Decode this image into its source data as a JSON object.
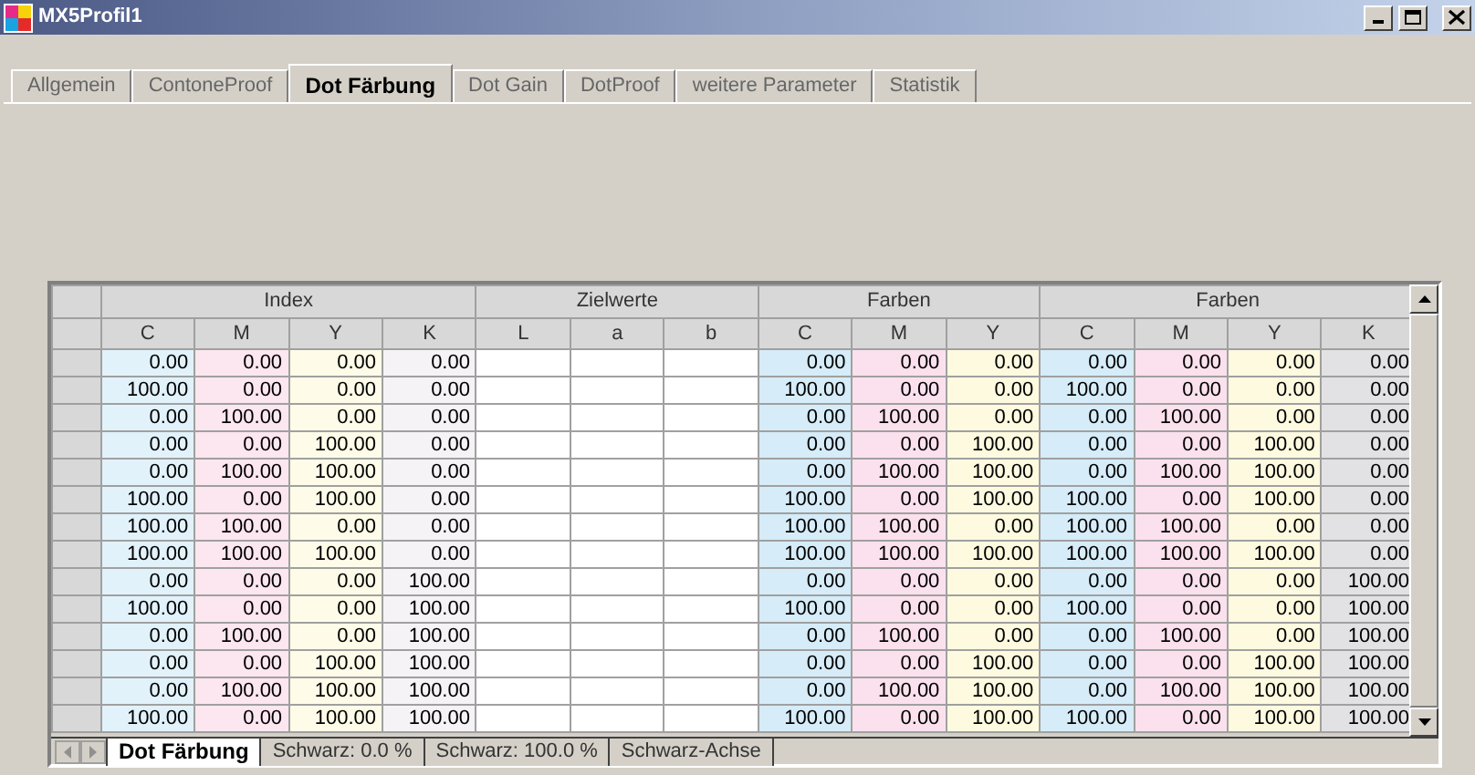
{
  "window": {
    "title": "MX5Profil1"
  },
  "tabs": [
    {
      "label": "Allgemein",
      "selected": false
    },
    {
      "label": "ContoneProof",
      "selected": false
    },
    {
      "label": "Dot Färbung",
      "selected": true
    },
    {
      "label": "Dot Gain",
      "selected": false
    },
    {
      "label": "DotProof",
      "selected": false
    },
    {
      "label": "weitere Parameter",
      "selected": false
    },
    {
      "label": "Statistik",
      "selected": false
    }
  ],
  "table": {
    "groups": [
      {
        "label": "Index",
        "kind": "values",
        "columns": [
          {
            "label": "C",
            "color": "#e2f2fb"
          },
          {
            "label": "M",
            "color": "#fce6f0"
          },
          {
            "label": "Y",
            "color": "#fefce8"
          },
          {
            "label": "K",
            "color": "#f5f3f5"
          }
        ]
      },
      {
        "label": "Zielwerte",
        "kind": "input",
        "columns": [
          {
            "label": "L",
            "color": "#ffffff"
          },
          {
            "label": "a",
            "color": "#ffffff"
          },
          {
            "label": "b",
            "color": "#ffffff"
          }
        ]
      },
      {
        "label": "Farben",
        "kind": "values",
        "columns": [
          {
            "label": "C",
            "color": "#d6ecf8"
          },
          {
            "label": "M",
            "color": "#fbe1ed"
          },
          {
            "label": "Y",
            "color": "#fdfae0"
          }
        ]
      },
      {
        "label": "Farben",
        "kind": "values",
        "columns": [
          {
            "label": "C",
            "color": "#d6ecf8"
          },
          {
            "label": "M",
            "color": "#fbe1ed"
          },
          {
            "label": "Y",
            "color": "#fdfae0"
          },
          {
            "label": "K",
            "color": "#e2e2e4"
          }
        ]
      }
    ],
    "rows": [
      {
        "values": [
          [
            "0.00",
            "0.00",
            "0.00",
            "0.00"
          ],
          [
            "0.00",
            "0.00",
            "0.00"
          ],
          [
            "0.00",
            "0.00",
            "0.00",
            "0.00"
          ]
        ]
      },
      {
        "values": [
          [
            "100.00",
            "0.00",
            "0.00",
            "0.00"
          ],
          [
            "100.00",
            "0.00",
            "0.00"
          ],
          [
            "100.00",
            "0.00",
            "0.00",
            "0.00"
          ]
        ]
      },
      {
        "values": [
          [
            "0.00",
            "100.00",
            "0.00",
            "0.00"
          ],
          [
            "0.00",
            "100.00",
            "0.00"
          ],
          [
            "0.00",
            "100.00",
            "0.00",
            "0.00"
          ]
        ]
      },
      {
        "values": [
          [
            "0.00",
            "0.00",
            "100.00",
            "0.00"
          ],
          [
            "0.00",
            "0.00",
            "100.00"
          ],
          [
            "0.00",
            "0.00",
            "100.00",
            "0.00"
          ]
        ]
      },
      {
        "values": [
          [
            "0.00",
            "100.00",
            "100.00",
            "0.00"
          ],
          [
            "0.00",
            "100.00",
            "100.00"
          ],
          [
            "0.00",
            "100.00",
            "100.00",
            "0.00"
          ]
        ]
      },
      {
        "values": [
          [
            "100.00",
            "0.00",
            "100.00",
            "0.00"
          ],
          [
            "100.00",
            "0.00",
            "100.00"
          ],
          [
            "100.00",
            "0.00",
            "100.00",
            "0.00"
          ]
        ]
      },
      {
        "values": [
          [
            "100.00",
            "100.00",
            "0.00",
            "0.00"
          ],
          [
            "100.00",
            "100.00",
            "0.00"
          ],
          [
            "100.00",
            "100.00",
            "0.00",
            "0.00"
          ]
        ]
      },
      {
        "values": [
          [
            "100.00",
            "100.00",
            "100.00",
            "0.00"
          ],
          [
            "100.00",
            "100.00",
            "100.00"
          ],
          [
            "100.00",
            "100.00",
            "100.00",
            "0.00"
          ]
        ]
      },
      {
        "values": [
          [
            "0.00",
            "0.00",
            "0.00",
            "100.00"
          ],
          [
            "0.00",
            "0.00",
            "0.00"
          ],
          [
            "0.00",
            "0.00",
            "0.00",
            "100.00"
          ]
        ]
      },
      {
        "values": [
          [
            "100.00",
            "0.00",
            "0.00",
            "100.00"
          ],
          [
            "100.00",
            "0.00",
            "0.00"
          ],
          [
            "100.00",
            "0.00",
            "0.00",
            "100.00"
          ]
        ]
      },
      {
        "values": [
          [
            "0.00",
            "100.00",
            "0.00",
            "100.00"
          ],
          [
            "0.00",
            "100.00",
            "0.00"
          ],
          [
            "0.00",
            "100.00",
            "0.00",
            "100.00"
          ]
        ]
      },
      {
        "values": [
          [
            "0.00",
            "0.00",
            "100.00",
            "100.00"
          ],
          [
            "0.00",
            "0.00",
            "100.00"
          ],
          [
            "0.00",
            "0.00",
            "100.00",
            "100.00"
          ]
        ]
      },
      {
        "values": [
          [
            "0.00",
            "100.00",
            "100.00",
            "100.00"
          ],
          [
            "0.00",
            "100.00",
            "100.00"
          ],
          [
            "0.00",
            "100.00",
            "100.00",
            "100.00"
          ]
        ]
      },
      {
        "values": [
          [
            "100.00",
            "0.00",
            "100.00",
            "100.00"
          ],
          [
            "100.00",
            "0.00",
            "100.00"
          ],
          [
            "100.00",
            "0.00",
            "100.00",
            "100.00"
          ]
        ]
      }
    ]
  },
  "sheet_tabs": [
    {
      "label": "Dot Färbung",
      "selected": true
    },
    {
      "label": "Schwarz: 0.0 %",
      "selected": false
    },
    {
      "label": "Schwarz: 100.0 %",
      "selected": false
    },
    {
      "label": "Schwarz-Achse",
      "selected": false
    }
  ]
}
